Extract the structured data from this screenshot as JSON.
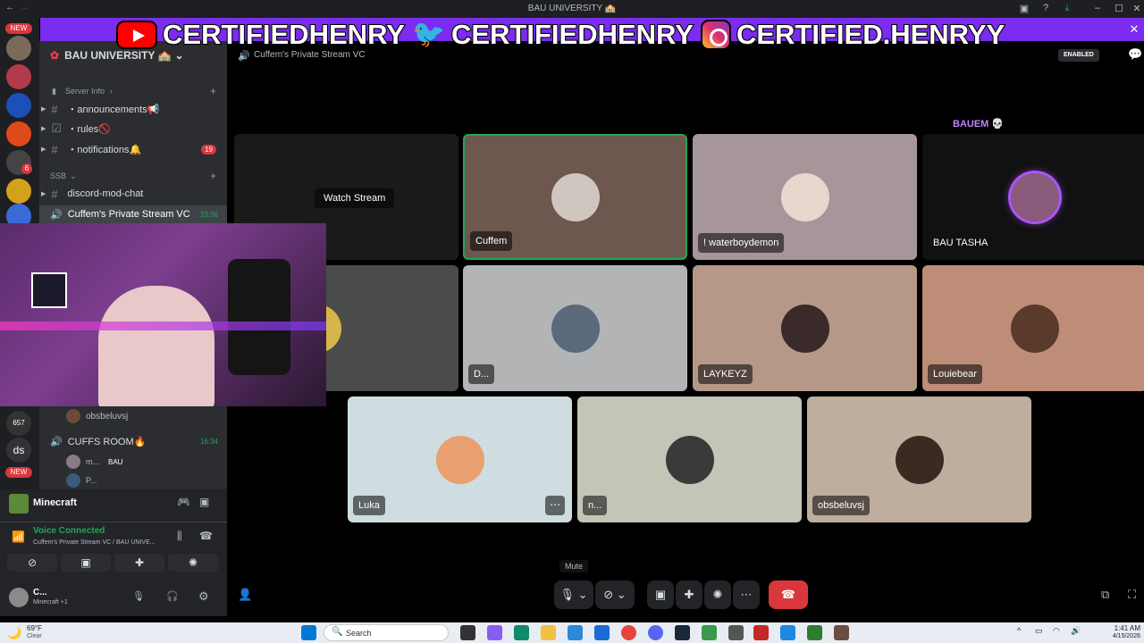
{
  "window": {
    "title": "BAU UNIVERSITY 🏫"
  },
  "banner": {
    "youtube": "CERTIFIEDHENRY",
    "twitter": "CERTIFIEDHENRY",
    "instagram": "CERTIFIED.HENRYY",
    "close_glyph": "✕"
  },
  "server": {
    "name": "BAU UNIVERSITY 🏫",
    "rail_badges": {
      "new1": "NEW",
      "new2": "NEW",
      "count": "6",
      "count2": "657",
      "ds": "ds"
    }
  },
  "channels": {
    "server_info": "Server Info",
    "announcements": "・announcements📢",
    "rules": "・rules🚫",
    "notifications": "・notifications🔔",
    "notifications_badge": "19",
    "category_ssb": "SSB",
    "mod_chat": "discord-mod-chat",
    "private_vc": "Cuffem's Private Stream VC",
    "private_vc_time": "23:36",
    "voice_member1": "obsbeluvsj",
    "cuffs_room": "CUFFS ROOM🔥",
    "cuffs_room_time": "16:34",
    "voice_member2": "m...",
    "voice_member2_tag": "BAU",
    "voice_member3": "P..."
  },
  "activity": {
    "game": "Minecraft"
  },
  "voice_status": {
    "title": "Voice Connected",
    "subtitle": "Cuffem's Private Stream VC / BAU UNIVE..."
  },
  "user": {
    "name": "C...",
    "status": "Minecraft +1"
  },
  "stage": {
    "channel_title": "Cuffem's Private Stream VC",
    "enabled_badge": "ENABLED",
    "watch_stream": "Watch Stream",
    "bauem_label": "BAUEM 💀",
    "mute_tooltip": "Mute",
    "tiles": [
      {
        "name": "Cuffem"
      },
      {
        "name": "! waterboydemon"
      },
      {
        "name": "BAU TASHA"
      },
      {
        "name": "D..."
      },
      {
        "name": "LAYKEYZ"
      },
      {
        "name": "Louiebear"
      },
      {
        "name": "Luka"
      },
      {
        "name": "n..."
      },
      {
        "name": "obsbeluvsj"
      }
    ]
  },
  "taskbar": {
    "weather_temp": "69°F",
    "weather_desc": "Clear",
    "search_placeholder": "Search",
    "time": "1:41 AM",
    "date": "4/15/2026"
  },
  "colors": {
    "discord_green": "#23a55a",
    "banner_purple": "#7b2cf0",
    "hangup_red": "#da373c"
  }
}
